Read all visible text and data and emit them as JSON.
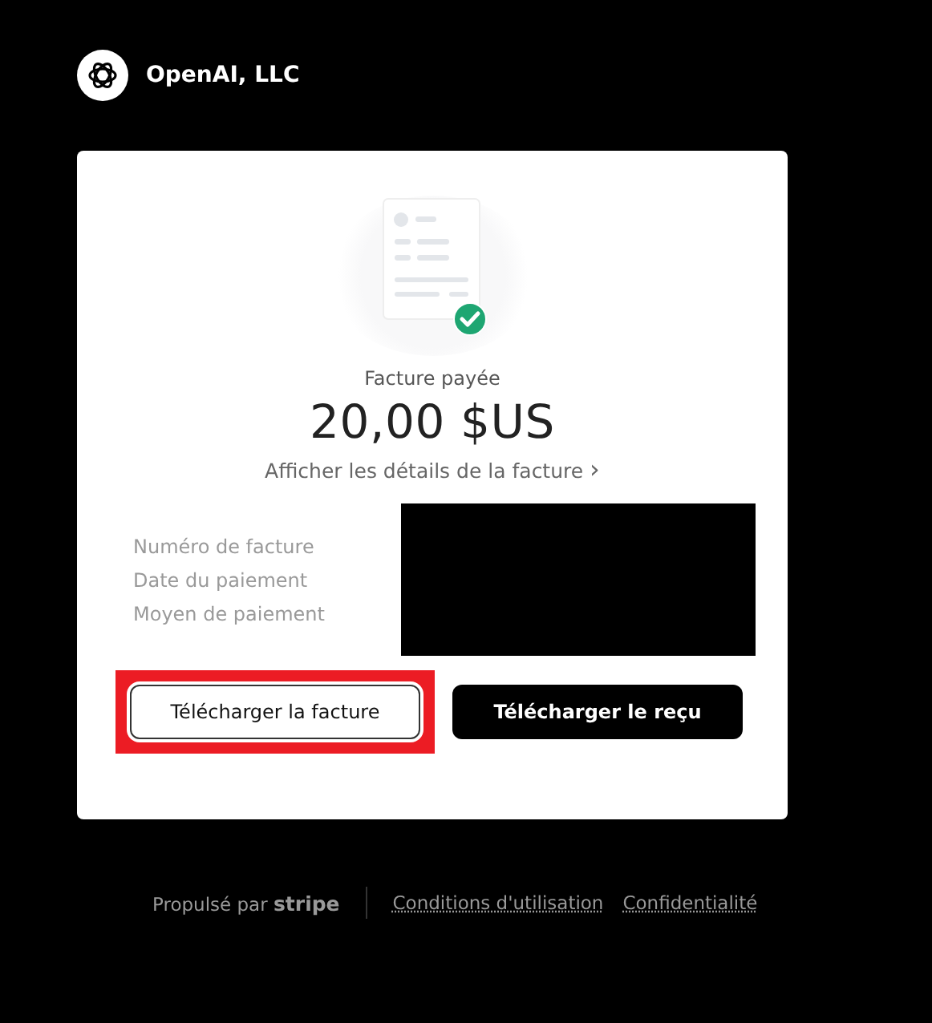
{
  "merchant": {
    "name": "OpenAI, LLC"
  },
  "invoice": {
    "status": "Facture payée",
    "paid": true,
    "amount": "20,00 $US",
    "details_link": "Afficher les détails de la facture",
    "details_chevron": "›"
  },
  "fields": [
    {
      "label": "Numéro de facture"
    },
    {
      "label": "Date du paiement"
    },
    {
      "label": "Moyen de paiement"
    }
  ],
  "redacted": true,
  "buttons": [
    {
      "label": "Télécharger la facture",
      "kind": "outline",
      "highlighted": true
    },
    {
      "label": "Télécharger le reçu",
      "kind": "filled",
      "highlighted": false
    }
  ],
  "footer": {
    "powered_by": "Propulsé par **stripe**",
    "links": [
      "Conditions d'utilisation",
      "Confidentialité"
    ]
  }
}
